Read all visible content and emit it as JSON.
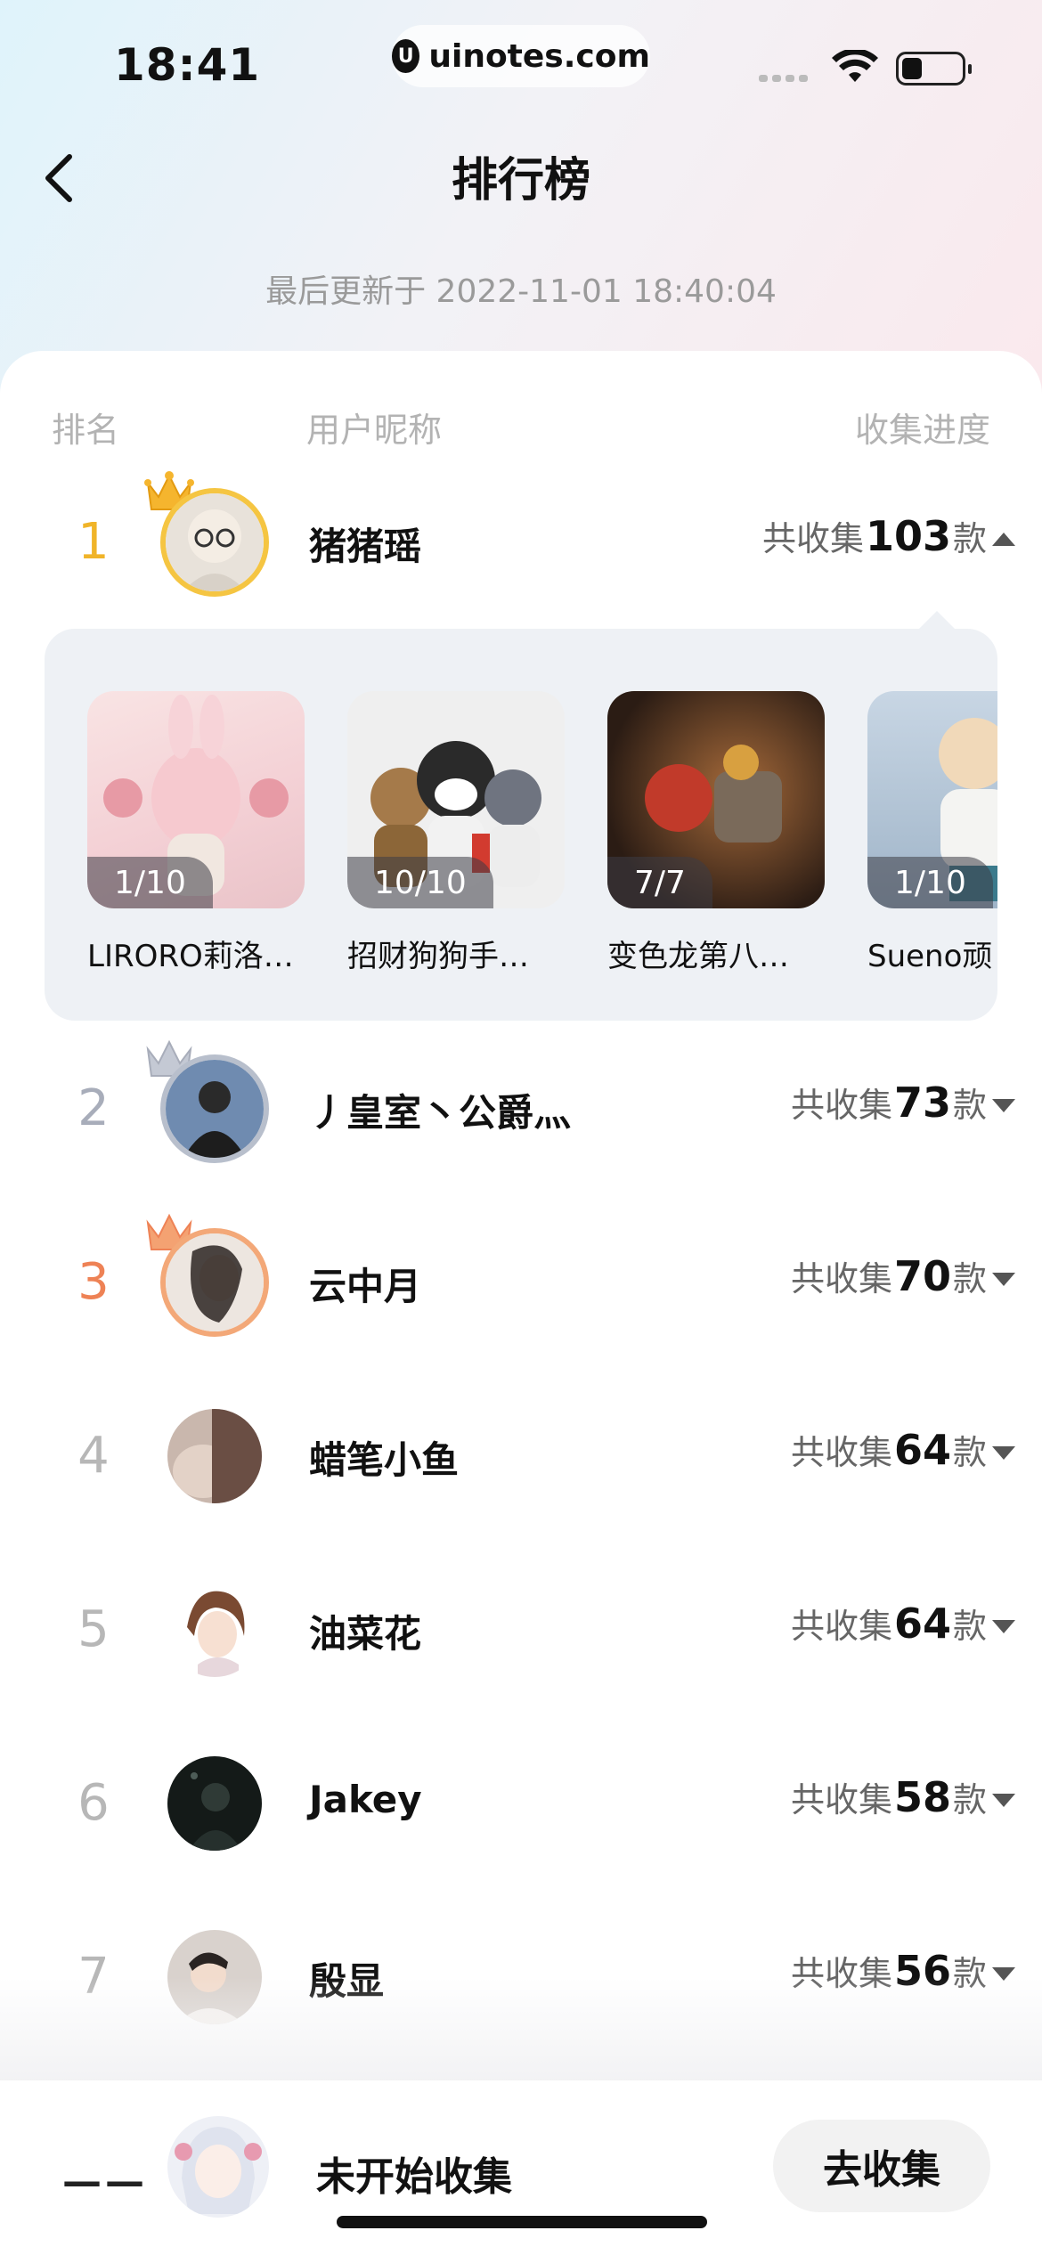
{
  "status_bar": {
    "time": "18:41",
    "url": "uinotes.com"
  },
  "header": {
    "title": "排行榜",
    "updated": "最后更新于 2022-11-01 18:40:04"
  },
  "columns": {
    "rank": "排名",
    "nickname": "用户昵称",
    "progress": "收集进度"
  },
  "progress_prefix": "共收集",
  "progress_suffix": "款",
  "rows": [
    {
      "rank": "1",
      "name": "猪猪瑶",
      "count": "103",
      "expanded": true
    },
    {
      "rank": "2",
      "name": "丿皇室丶公爵灬",
      "count": "73"
    },
    {
      "rank": "3",
      "name": "云中月",
      "count": "70"
    },
    {
      "rank": "4",
      "name": "蜡笔小鱼",
      "count": "64"
    },
    {
      "rank": "5",
      "name": "油菜花",
      "count": "64"
    },
    {
      "rank": "6",
      "name": "Jakey",
      "count": "58"
    },
    {
      "rank": "7",
      "name": "殷显",
      "count": "56"
    }
  ],
  "expanded_items": [
    {
      "count": "1/10",
      "name": "LIRORO莉洛…"
    },
    {
      "count": "10/10",
      "name": "招财狗狗手…"
    },
    {
      "count": "7/7",
      "name": "变色龙第八…"
    },
    {
      "count": "1/10",
      "name": "Sueno顽"
    }
  ],
  "bottom": {
    "rank": "——",
    "status": "未开始收集",
    "button": "去收集"
  },
  "colors": {
    "gold": "#f0b429",
    "silver": "#a8adba",
    "bronze": "#ee8255"
  },
  "icons": [
    "back-arrow-icon",
    "wifi-icon",
    "battery-icon",
    "crown-icon",
    "caret-down-icon",
    "caret-up-icon"
  ]
}
